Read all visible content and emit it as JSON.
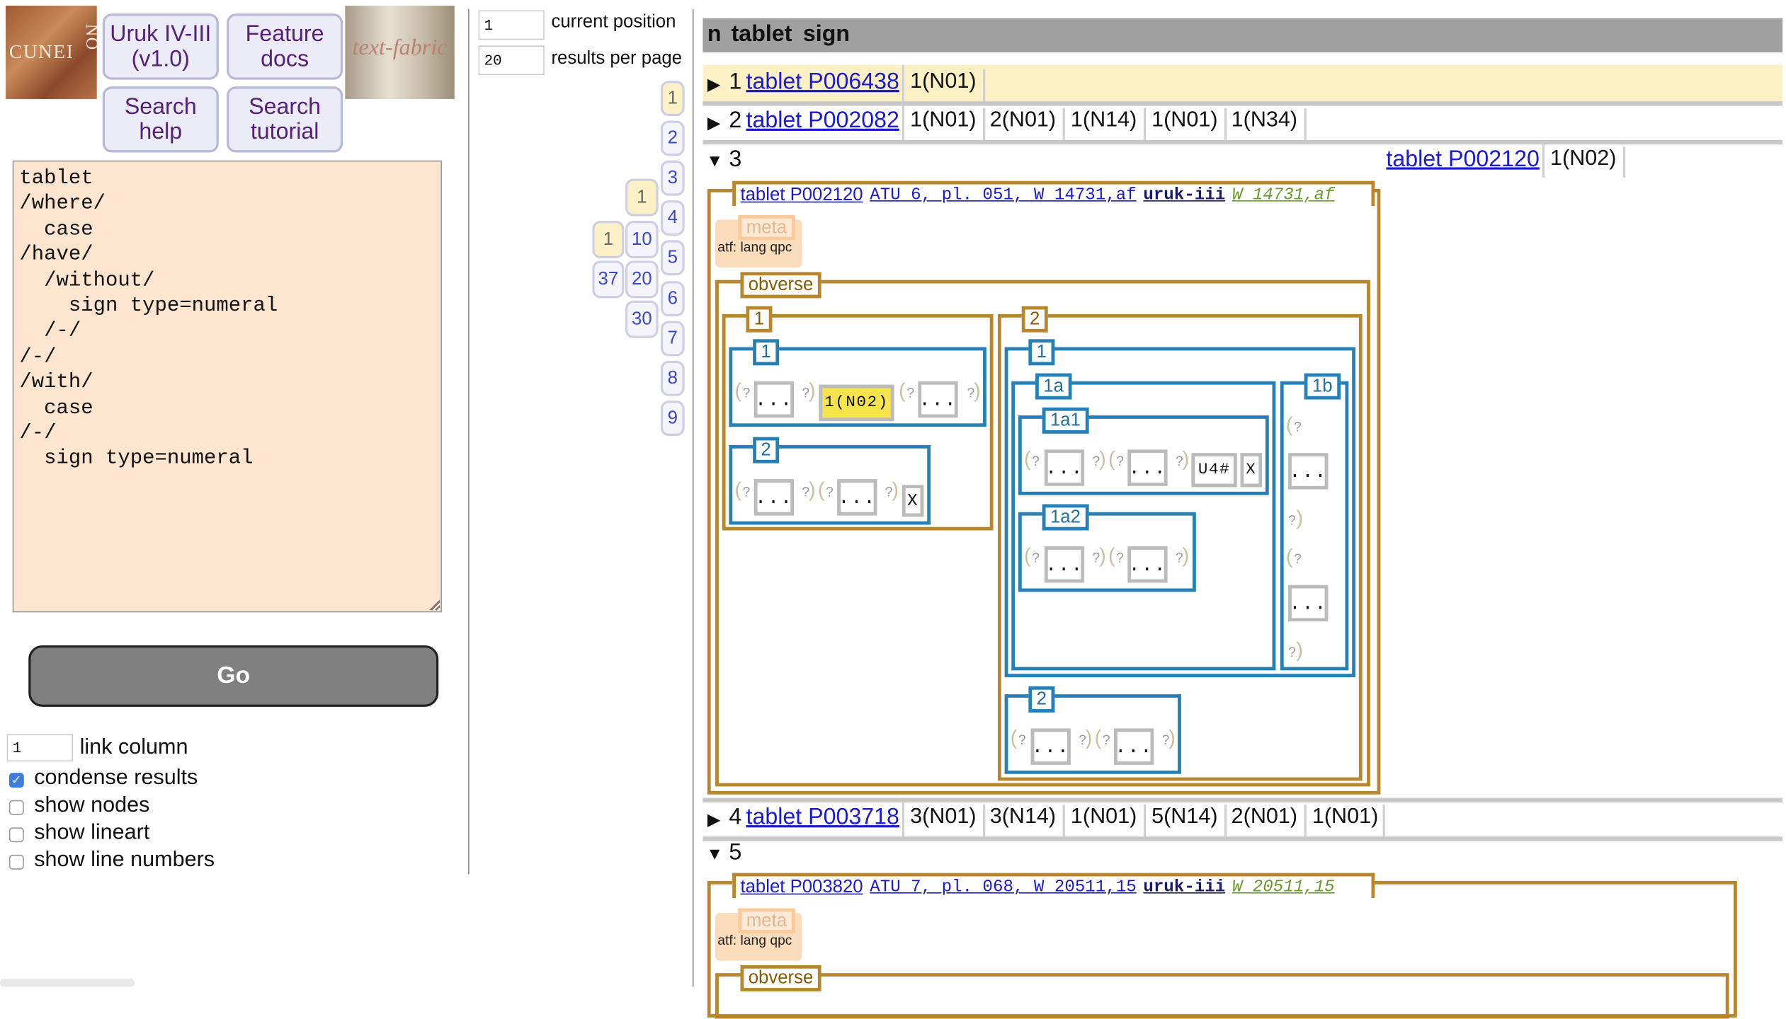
{
  "header": {
    "logo_left": "CUNEI",
    "logo_right": "NO",
    "app_button": [
      "Uruk IV-III",
      "(v1.0)"
    ],
    "feature_docs": [
      "Feature",
      "docs"
    ],
    "search_help": [
      "Search",
      "help"
    ],
    "search_tutorial": [
      "Search",
      "tutorial"
    ],
    "tf_logo": "text-fabric"
  },
  "query": "tablet\n/where/\n  case\n/have/\n  /without/\n    sign type=numeral\n  /-/\n/-/\n/with/\n  case\n/-/\n  sign type=numeral",
  "go_label": "Go",
  "options": {
    "link_column_value": "1",
    "link_column_label": "link column",
    "condense": "condense results",
    "show_nodes": "show nodes",
    "show_lineart": "show lineart",
    "show_line_numbers": "show line numbers"
  },
  "navigation": {
    "position_value": "1",
    "position_label": "current position",
    "per_page_value": "20",
    "per_page_label": "results per page",
    "pages": [
      "1",
      "2",
      "3",
      "4",
      "5",
      "6",
      "7",
      "8",
      "9"
    ],
    "stride_10": [
      "1",
      "10",
      "20",
      "30"
    ],
    "stride_100": [
      "1",
      "37"
    ]
  },
  "table": {
    "headers": [
      "n",
      "tablet",
      "sign"
    ],
    "rows": [
      {
        "n": "1",
        "tablet": "tablet P006438",
        "signs": [
          "1(N01)"
        ]
      },
      {
        "n": "2",
        "tablet": "tablet P002082",
        "signs": [
          "1(N01)",
          "2(N01)",
          "1(N14)",
          "1(N01)",
          "1(N34)"
        ]
      },
      {
        "n": "3",
        "tablet": "tablet P002120",
        "signs": [
          "1(N02)"
        ]
      },
      {
        "n": "4",
        "tablet": "tablet P003718",
        "signs": [
          "3(N01)",
          "3(N14)",
          "1(N01)",
          "5(N14)",
          "2(N01)",
          "1(N01)"
        ]
      },
      {
        "n": "5"
      }
    ]
  },
  "detail3": {
    "tablet_link": "tablet P002120",
    "atu": "ATU 6, pl. 051, W 14731,af",
    "period": "uruk-iii",
    "museum": "W 14731,af",
    "meta_label": "meta",
    "meta_atf": "atf: lang qpc",
    "face": "obverse",
    "col1": "1",
    "col2": "2",
    "c1l1": "1",
    "c1l2": "2",
    "c2l1": "1",
    "c2l2": "2",
    "case_1a": "1a",
    "case_1a1": "1a1",
    "case_1a2": "1a2",
    "case_1b": "1b",
    "dots": "...",
    "sign_hl": "1(N02)",
    "sign_x": "X",
    "sign_u4": "U4#",
    "q": "?"
  },
  "detail5": {
    "tablet_link": "tablet P003820",
    "atu": "ATU 7, pl. 068, W 20511,15",
    "period": "uruk-iii",
    "museum": "W 20511,15",
    "meta_label": "meta",
    "meta_atf": "atf: lang qpc",
    "face": "obverse"
  }
}
